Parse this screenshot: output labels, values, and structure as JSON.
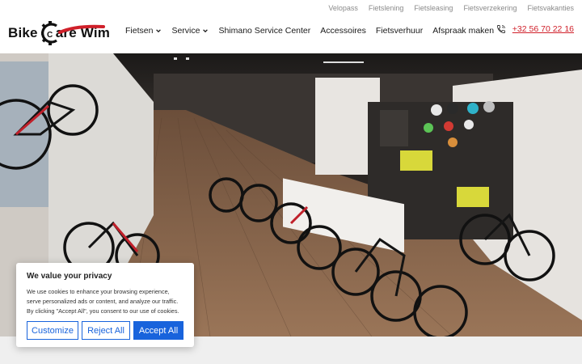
{
  "utility_nav": [
    "Velopass",
    "Fietslening",
    "Fietsleasing",
    "Fietsverzekering",
    "Fietsvakanties"
  ],
  "logo": {
    "word1": "Bike",
    "word2": "are Wim",
    "letter": "C",
    "accent": "#d0202a"
  },
  "nav": {
    "items": [
      {
        "label": "Fietsen",
        "dropdown": true
      },
      {
        "label": "Service",
        "dropdown": true
      },
      {
        "label": "Shimano Service Center",
        "dropdown": false
      },
      {
        "label": "Accessoires",
        "dropdown": false
      },
      {
        "label": "Fietsverhuur",
        "dropdown": false
      },
      {
        "label": "Afspraak maken",
        "dropdown": false
      }
    ]
  },
  "phone": {
    "icon": "phone-icon",
    "number": "+32 56 70 22 16"
  },
  "hero": {
    "alt_icon": "bike-shop-photo"
  },
  "cookie": {
    "title": "We value your privacy",
    "text": "We use cookies to enhance your browsing experience, serve personalized ads or content, and analyze our traffic. By clicking \"Accept All\", you consent to our use of cookies.",
    "customize": "Customize",
    "reject": "Reject All",
    "accept": "Accept All",
    "accent": "#1863dc"
  }
}
